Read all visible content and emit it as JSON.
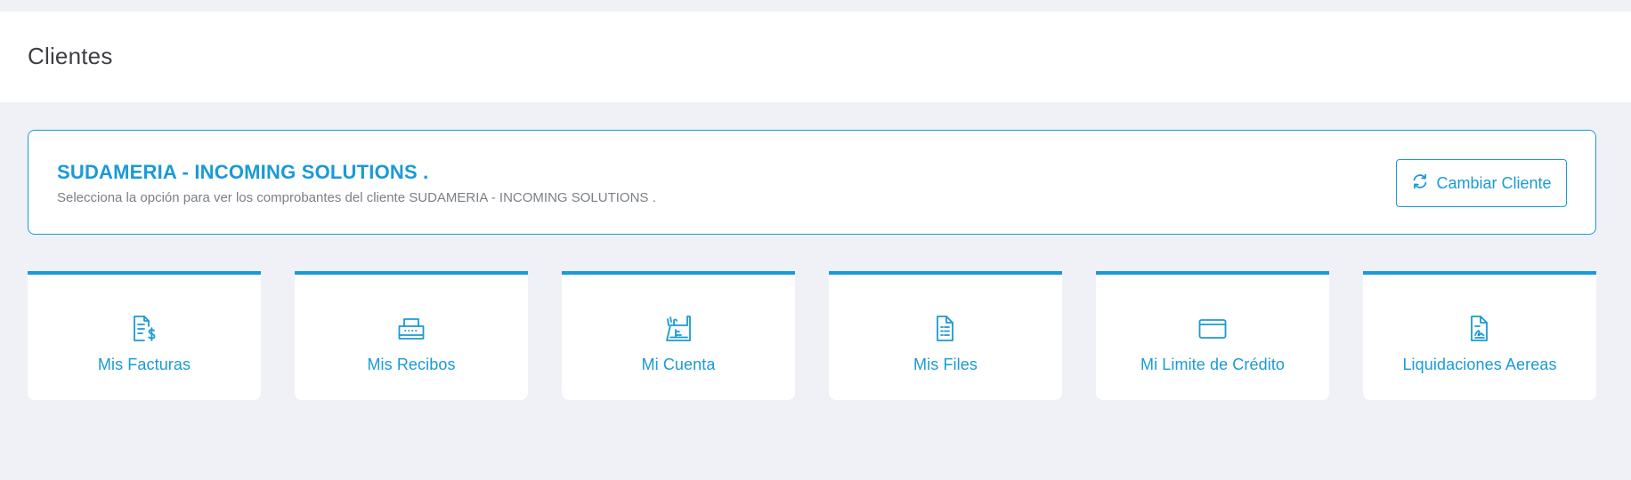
{
  "page": {
    "title": "Clientes"
  },
  "client": {
    "name": "SUDAMERIA - INCOMING SOLUTIONS .",
    "description": "Selecciona la opción para ver los comprobantes del cliente SUDAMERIA - INCOMING SOLUTIONS .",
    "change_button_label": "Cambiar Cliente",
    "change_button_icon": "refresh-icon"
  },
  "tiles": [
    {
      "label": "Mis Facturas",
      "icon": "invoice-dollar-icon"
    },
    {
      "label": "Mis Recibos",
      "icon": "receipt-printer-icon"
    },
    {
      "label": "Mi Cuenta",
      "icon": "cash-register-icon"
    },
    {
      "label": "Mis Files",
      "icon": "file-lines-icon"
    },
    {
      "label": "Mi Limite de Crédito",
      "icon": "credit-card-icon"
    },
    {
      "label": "Liquidaciones Aereas",
      "icon": "file-signature-icon"
    }
  ],
  "colors": {
    "accent": "#1a9ad6",
    "background": "#f0f1f7",
    "card": "#ffffff",
    "title_text": "#3d3f44",
    "muted_text": "#7b7f86"
  }
}
